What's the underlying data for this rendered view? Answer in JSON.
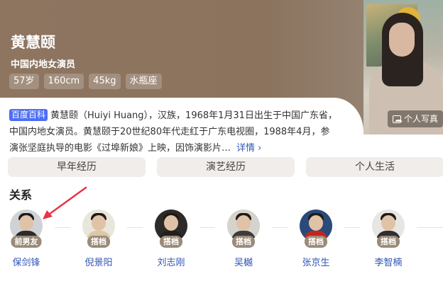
{
  "person": {
    "name": "黄慧颐",
    "occupation": "中国内地女演员",
    "tags": [
      "57岁",
      "160cm",
      "45kg",
      "水瓶座"
    ],
    "photo_button": "个人写真"
  },
  "summary": {
    "badge": "百度百科",
    "text": "黄慧颐（Huiyi Huang），汉族，1968年1月31日出生于中国广东省，中国内地女演员。黄慧颐于20世纪80年代走红于广东电视圈，1988年4月，参演张坚庭执导的电影《过埠新娘》上映，因饰演影片…",
    "more": "详情 ›"
  },
  "sections": [
    "早年经历",
    "演艺经历",
    "个人生活"
  ],
  "relations": {
    "title": "关系",
    "items": [
      {
        "role": "前男友",
        "name": "保剑锋",
        "shirt": "#2b2b2b",
        "bg": "#cfd3d6"
      },
      {
        "role": "搭档",
        "name": "倪景阳",
        "shirt": "#d9c9a6",
        "bg": "#e9e6dc"
      },
      {
        "role": "搭档",
        "name": "刘志刚",
        "shirt": "#1f1f1f",
        "bg": "#2e2a28"
      },
      {
        "role": "搭档",
        "name": "吴樾",
        "shirt": "#3b3b3b",
        "bg": "#d6d2cc"
      },
      {
        "role": "搭档",
        "name": "张京生",
        "shirt": "#c8241e",
        "bg": "#2a4a7a"
      },
      {
        "role": "搭档",
        "name": "李智楠",
        "shirt": "#2f2f33",
        "bg": "#e8e6e2"
      }
    ]
  },
  "colors": {
    "hero": "#8d7560",
    "accent_link": "#3056b5",
    "badge": "#4e6ef2",
    "arrow": "#e8334a"
  }
}
